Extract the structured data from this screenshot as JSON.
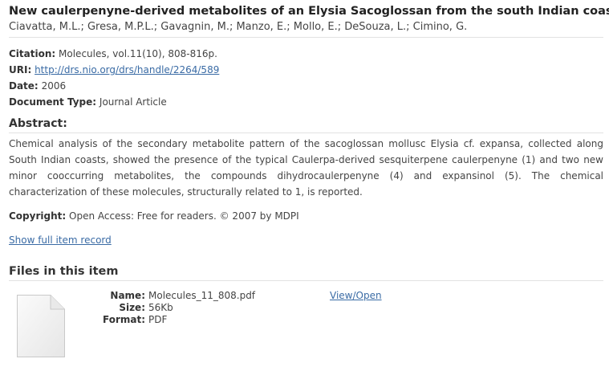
{
  "item": {
    "title": "New caulerpenyne-derived metabolites of an Elysia Sacoglossan from the south Indian coast",
    "authors": "Ciavatta, M.L.; Gresa, M.P.L.; Gavagnin, M.; Manzo, E.; Mollo, E.; DeSouza, L.; Cimino, G."
  },
  "metadata": {
    "citation_label": "Citation:",
    "citation_value": "Molecules, vol.11(10), 808-816p.",
    "uri_label": "URI:",
    "uri_value": "http://drs.nio.org/drs/handle/2264/589",
    "date_label": "Date:",
    "date_value": "2006",
    "doctype_label": "Document Type:",
    "doctype_value": "Journal Article"
  },
  "abstract": {
    "heading": "Abstract:",
    "text": "Chemical analysis of the secondary metabolite pattern of the sacoglossan mollusc Elysia cf. expansa, collected along South Indian coasts, showed the presence of the typical Caulerpa-derived sesquiterpene caulerpenyne (1) and two new minor cooccurring metabolites, the compounds dihydrocaulerpenyne (4) and expansinol (5). The chemical characterization of these molecules, structurally related to 1, is reported."
  },
  "copyright": {
    "label": "Copyright:",
    "value": "Open Access: Free for readers. © 2007 by MDPI"
  },
  "show_full_link": "Show full item record",
  "files": {
    "heading": "Files in this item",
    "items": [
      {
        "icon": "generic-file-icon",
        "name_label": "Name:",
        "name_value": "Molecules_11_808.pdf",
        "size_label": "Size:",
        "size_value": "56Kb",
        "format_label": "Format:",
        "format_value": "PDF",
        "view_open_label": "View/Open"
      }
    ]
  }
}
